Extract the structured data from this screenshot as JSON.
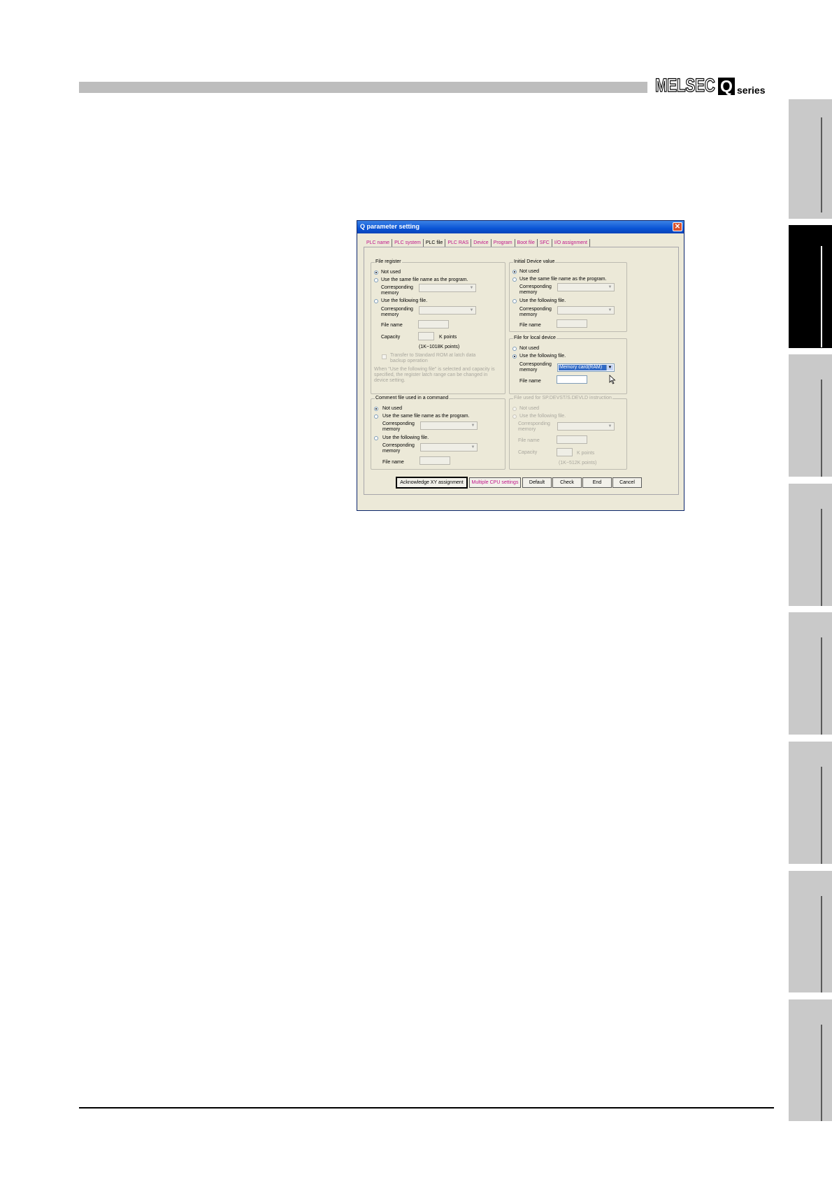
{
  "header": {
    "brand_name": "MELSEC",
    "brand_q": "Q",
    "brand_suffix": "series"
  },
  "side_tabs": {
    "count": 8,
    "active_index": 1
  },
  "dialog": {
    "title": "Q parameter setting",
    "tabs": [
      "PLC name",
      "PLC system",
      "PLC file",
      "PLC RAS",
      "Device",
      "Program",
      "Boot file",
      "SFC",
      "I/O assignment"
    ],
    "selected_tab": "PLC file",
    "file_register": {
      "label": "File register",
      "not_used": "Not used",
      "same_name": "Use the same file name as the program.",
      "corresponding_memory_1": "Corresponding",
      "corresponding_memory_2": "memory",
      "use_following": "Use the following file.",
      "file_name": "File name",
      "capacity": "Capacity",
      "k_points": "K points",
      "range": "(1K~1018K points)",
      "transfer_line1": "Transfer to Standard ROM at latch data",
      "transfer_line2": "backup operation",
      "note_line1": "When \"Use the following file\" is selected and capacity is",
      "note_line2": "specified, the register latch range can be changed in",
      "note_line3": "device setting."
    },
    "initial_device": {
      "label": "Initial Device value",
      "not_used": "Not used",
      "same_name": "Use the same file name as the program.",
      "corresponding_memory_1": "Corresponding",
      "corresponding_memory_2": "memory",
      "use_following": "Use the following file.",
      "file_name": "File name"
    },
    "local_device": {
      "label": "File for local device",
      "not_used": "Not used",
      "use_following": "Use the following file.",
      "corresponding_memory_1": "Corresponding",
      "corresponding_memory_2": "memory",
      "memory_value": "Memory card(RAM)",
      "file_name": "File name"
    },
    "comment_file": {
      "label": "Comment file used in a command",
      "not_used": "Not used",
      "same_name": "Use the same file name as the program.",
      "corresponding_memory_1": "Corresponding",
      "corresponding_memory_2": "memory",
      "use_following": "Use the following file.",
      "file_name": "File name"
    },
    "sp_device": {
      "label": "File used for SP.DEVST/S.DEVLD instruction",
      "not_used": "Not used",
      "use_following": "Use the following file.",
      "corresponding_memory_1": "Corresponding",
      "corresponding_memory_2": "memory",
      "file_name": "File name",
      "capacity": "Capacity",
      "k_points": "K points",
      "range": "(1K~512K points)"
    },
    "buttons": {
      "acknowledge": "Acknowledge XY assignment",
      "multiple_cpu": "Multiple CPU settings",
      "default": "Default",
      "check": "Check",
      "end": "End",
      "cancel": "Cancel"
    }
  }
}
